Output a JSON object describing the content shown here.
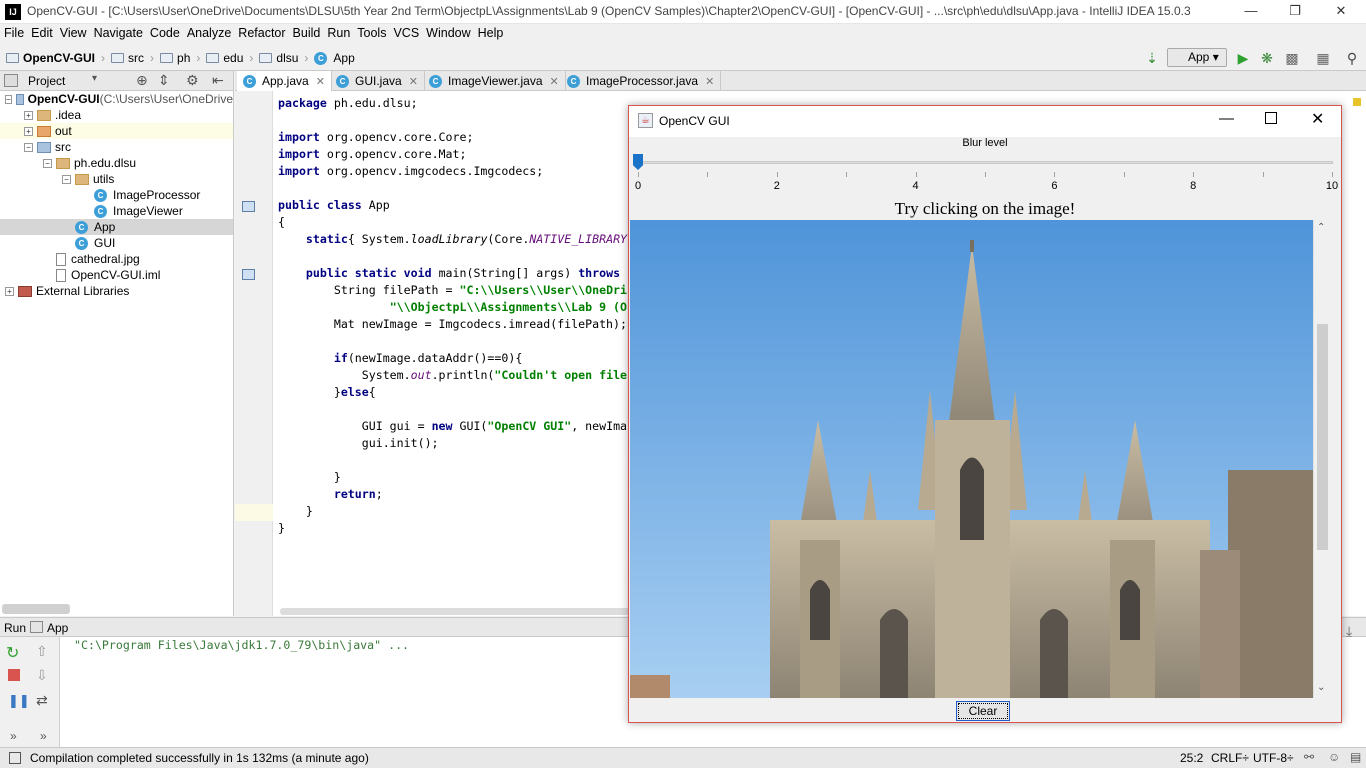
{
  "window": {
    "title": "OpenCV-GUI - [C:\\Users\\User\\OneDrive\\Documents\\DLSU\\5th Year 2nd Term\\ObjectpL\\Assignments\\Lab 9 (OpenCV Samples)\\Chapter2\\OpenCV-GUI] - [OpenCV-GUI] - ...\\src\\ph\\edu\\dlsu\\App.java - IntelliJ IDEA 15.0.3",
    "app_icon": "IJ"
  },
  "menu": [
    "File",
    "Edit",
    "View",
    "Navigate",
    "Code",
    "Analyze",
    "Refactor",
    "Build",
    "Run",
    "Tools",
    "VCS",
    "Window",
    "Help"
  ],
  "breadcrumbs": [
    "OpenCV-GUI",
    "src",
    "ph",
    "edu",
    "dlsu",
    "App"
  ],
  "run_config": "App",
  "project_panel": {
    "title": "Project",
    "tree": [
      {
        "label": "OpenCV-GUI",
        "suffix": " (C:\\Users\\User\\OneDrive",
        "indent": 0,
        "toggle": "−",
        "icon": "folder-blue"
      },
      {
        "label": ".idea",
        "indent": 1,
        "toggle": "+",
        "icon": "folder"
      },
      {
        "label": "out",
        "indent": 1,
        "toggle": "+",
        "icon": "folder-orange"
      },
      {
        "label": "src",
        "indent": 1,
        "toggle": "−",
        "icon": "folder-blue"
      },
      {
        "label": "ph.edu.dlsu",
        "indent": 2,
        "toggle": "−",
        "icon": "folder"
      },
      {
        "label": "utils",
        "indent": 3,
        "toggle": "−",
        "icon": "folder"
      },
      {
        "label": "ImageProcessor",
        "indent": 4,
        "toggle": "",
        "icon": "class"
      },
      {
        "label": "ImageViewer",
        "indent": 4,
        "toggle": "",
        "icon": "class"
      },
      {
        "label": "App",
        "indent": 3,
        "toggle": "",
        "icon": "class"
      },
      {
        "label": "GUI",
        "indent": 3,
        "toggle": "",
        "icon": "class"
      },
      {
        "label": "cathedral.jpg",
        "indent": 2,
        "toggle": "",
        "icon": "file"
      },
      {
        "label": "OpenCV-GUI.iml",
        "indent": 2,
        "toggle": "",
        "icon": "file"
      },
      {
        "label": "External Libraries",
        "indent": 0,
        "toggle": "+",
        "icon": "lib"
      }
    ]
  },
  "editor_tabs": [
    {
      "label": "App.java",
      "active": true
    },
    {
      "label": "GUI.java",
      "active": false
    },
    {
      "label": "ImageViewer.java",
      "active": false
    },
    {
      "label": "ImageProcessor.java",
      "active": false
    }
  ],
  "code_lines": [
    "package ph.edu.dlsu;",
    "",
    "import org.opencv.core.Core;",
    "import org.opencv.core.Mat;",
    "import org.opencv.imgcodecs.Imgcodecs;",
    "",
    "public class App",
    "{",
    "    static{ System.loadLibrary(Core.NATIVE_LIBRARY",
    "",
    "    public static void main(String[] args) throws",
    "        String filePath = \"C:\\\\Users\\\\User\\\\OneDri",
    "                \"\\\\ObjectpL\\\\Assignments\\\\Lab 9 (O",
    "        Mat newImage = Imgcodecs.imread(filePath);",
    "",
    "        if(newImage.dataAddr()==0){",
    "            System.out.println(\"Couldn't open file",
    "        }else{",
    "",
    "            GUI gui = new GUI(\"OpenCV GUI\", newIma",
    "            gui.init();",
    "",
    "        }",
    "        return;",
    "    }",
    "}"
  ],
  "run_panel": {
    "label": "Run",
    "tab": "App",
    "output": "\"C:\\Program Files\\Java\\jdk1.7.0_79\\bin\\java\" ..."
  },
  "status": {
    "message": "Compilation completed successfully in 1s 132ms (a minute ago)",
    "position": "25:2",
    "line_sep": "CRLF÷",
    "encoding": "UTF-8÷"
  },
  "dialog": {
    "title": "OpenCV GUI",
    "slider_label": "Blur level",
    "slider_value": 0,
    "slider_min": 0,
    "slider_max": 10,
    "tick_labels": [
      "0",
      "2",
      "4",
      "6",
      "8",
      "10"
    ],
    "prompt": "Try clicking on the image!",
    "clear_label": "Clear"
  },
  "colors": {
    "accent": "#1a73c9",
    "dialog_border": "#d9534f",
    "string": "#008000",
    "keyword": "#000080"
  }
}
